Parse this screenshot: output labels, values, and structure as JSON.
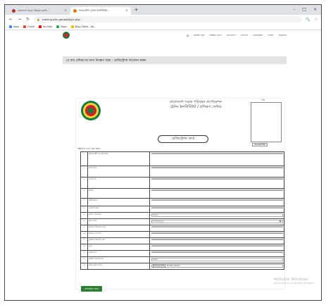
{
  "browser": {
    "tabs": [
      {
        "title": "বাংলাদেশ সড়ক পরিবহন কর্পো...",
        "favicon_color": "#c62828",
        "active": false
      },
      {
        "title": "বিআরটিসি ট্রেনিং ইনস্টিটিউট...",
        "favicon_color": "#e8710a",
        "active": true
      }
    ],
    "new_tab": "+",
    "address": "training-brtc.gov.bd/b/g/c.php",
    "bookmarks": [
      {
        "label": "Apps",
        "color": "#4285f4"
      },
      {
        "label": "Gmail",
        "color": "#ea4335"
      },
      {
        "label": "YouTube",
        "color": "#ff0000"
      },
      {
        "label": "Maps",
        "color": "#34a853"
      },
      {
        "label": "Bijoy Editor - Ba...",
        "color": "#fbbc05"
      }
    ]
  },
  "site": {
    "nav": [
      "প্রশিক্ষণ সূচি",
      "প্রশিক্ষণ কোর্স",
      "যোগাযোগ",
      "ফলাফল",
      "রেজিস্ট্রেশন",
      "লগইন",
      "অ্যাডমিন"
    ],
    "page_title": "২য় বার প্রশিক্ষণের জন্য নিবন্ধন ফরম : রেজিস্ট্রেশন আবেদন করুন"
  },
  "form": {
    "org_line1": "বাংলাদেশ সড়ক পরিবহন কর্পোরেশন",
    "org_line2": "ট্রেনিং ইনস্টিটিউট / প্রশিক্ষণ সেন্টার",
    "photo_label": "ছবি",
    "choose_file": "Choose File",
    "card_title": "রেজিস্ট্রেশন কার্ড",
    "instruction": "নিম্নলিখিত তথ্য পূরণ করুন :",
    "rows": [
      {
        "num": "১",
        "label": "প্রশিক্ষণার্থীর নাম (বাংলায়)",
        "value": ""
      },
      {
        "num": "২",
        "label": "পিতার নাম",
        "value": ""
      },
      {
        "num": "৩",
        "label": "মাতার নাম",
        "value": ""
      },
      {
        "num": "৪",
        "label": "ঠিকানা",
        "value": ""
      },
      {
        "num": "৫",
        "label": "স্থায়ী ঠিকানা",
        "value": ""
      },
      {
        "num": "৬",
        "label": "মোবাইল নম্বর",
        "value": ""
      },
      {
        "num": "৭",
        "label": "জেলা / উপজেলা",
        "value": "Select",
        "kind": "select"
      },
      {
        "num": "৮",
        "label": "জন্ম তারিখ",
        "value": "mm/dd/yyyy",
        "kind": "date"
      },
      {
        "num": "৯",
        "label": "জাতীয় পরিচয়পত্র নম্বর",
        "value": ""
      },
      {
        "num": "১০",
        "label": "শিক্ষাগত যোগ্যতা",
        "value": ""
      },
      {
        "num": "১১",
        "label": "ড্রাইভিং লাইসেন্স নম্বর",
        "value": ""
      },
      {
        "num": "১২",
        "label": "পেশা",
        "value": ""
      },
      {
        "num": "১৩",
        "label": "রক্তের গ্রুপ",
        "value": ""
      },
      {
        "num": "১৪",
        "label": "প্রশিক্ষণ কোর্সের নাম",
        "value": "Select",
        "kind": "select"
      },
      {
        "num": "১৫",
        "label": "স্বাক্ষর (স্ক্যান কপি)",
        "value": "No file chosen",
        "kind": "file"
      }
    ],
    "submit": "রেজিস্ট্রেশন করুন"
  },
  "watermark": {
    "line1": "Activate Windows",
    "line2": "Go to Settings to activate Windows."
  }
}
